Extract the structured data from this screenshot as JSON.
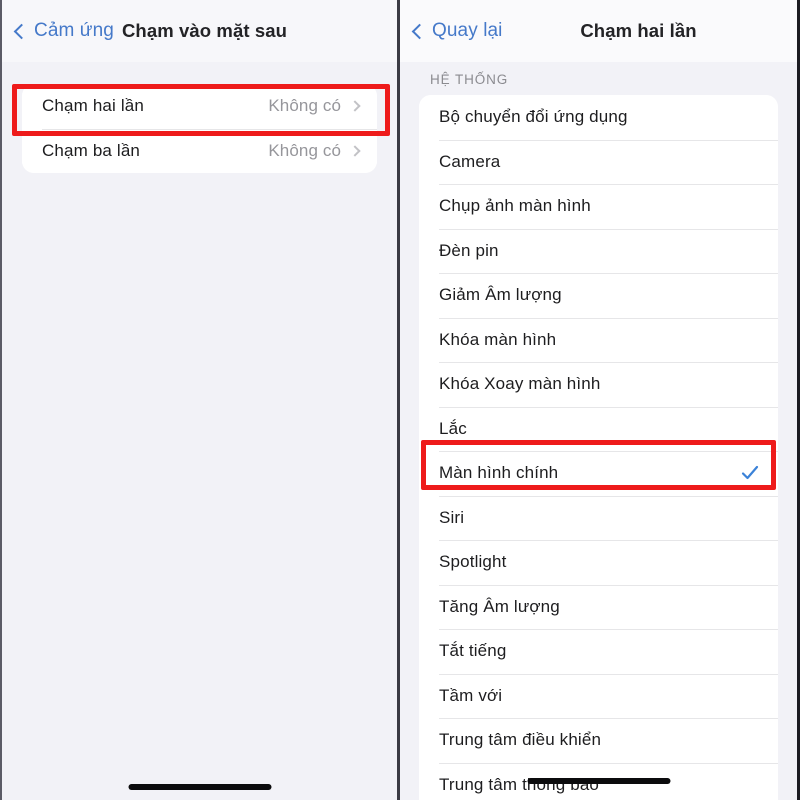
{
  "theme": {
    "accent_blue": "#4579c9",
    "check_blue": "#3b82d8",
    "highlight_red": "#ee1b1b",
    "value_gray": "#96969b",
    "background": "#f2f2f7"
  },
  "left_panel": {
    "back_label": "Cảm ứng",
    "title": "Chạm vào mặt sau",
    "rows": [
      {
        "label": "Chạm hai lần",
        "value": "Không có",
        "highlighted": true
      },
      {
        "label": "Chạm ba lần",
        "value": "Không có",
        "highlighted": false
      }
    ]
  },
  "right_panel": {
    "back_label": "Quay lại",
    "title": "Chạm hai lần",
    "section_header": "HỆ THỐNG",
    "rows": [
      {
        "label": "Bộ chuyển đổi ứng dụng",
        "selected": false
      },
      {
        "label": "Camera",
        "selected": false
      },
      {
        "label": "Chụp ảnh màn hình",
        "selected": false
      },
      {
        "label": "Đèn pin",
        "selected": false
      },
      {
        "label": "Giảm Âm lượng",
        "selected": false
      },
      {
        "label": "Khóa màn hình",
        "selected": false
      },
      {
        "label": "Khóa Xoay màn hình",
        "selected": false
      },
      {
        "label": "Lắc",
        "selected": false
      },
      {
        "label": "Màn hình chính",
        "selected": true
      },
      {
        "label": "Siri",
        "selected": false
      },
      {
        "label": "Spotlight",
        "selected": false
      },
      {
        "label": "Tăng Âm lượng",
        "selected": false
      },
      {
        "label": "Tắt tiếng",
        "selected": false
      },
      {
        "label": "Tầm với",
        "selected": false
      },
      {
        "label": "Trung tâm điều khiển",
        "selected": false
      },
      {
        "label": "Trung tâm thông báo",
        "selected": false
      }
    ]
  }
}
